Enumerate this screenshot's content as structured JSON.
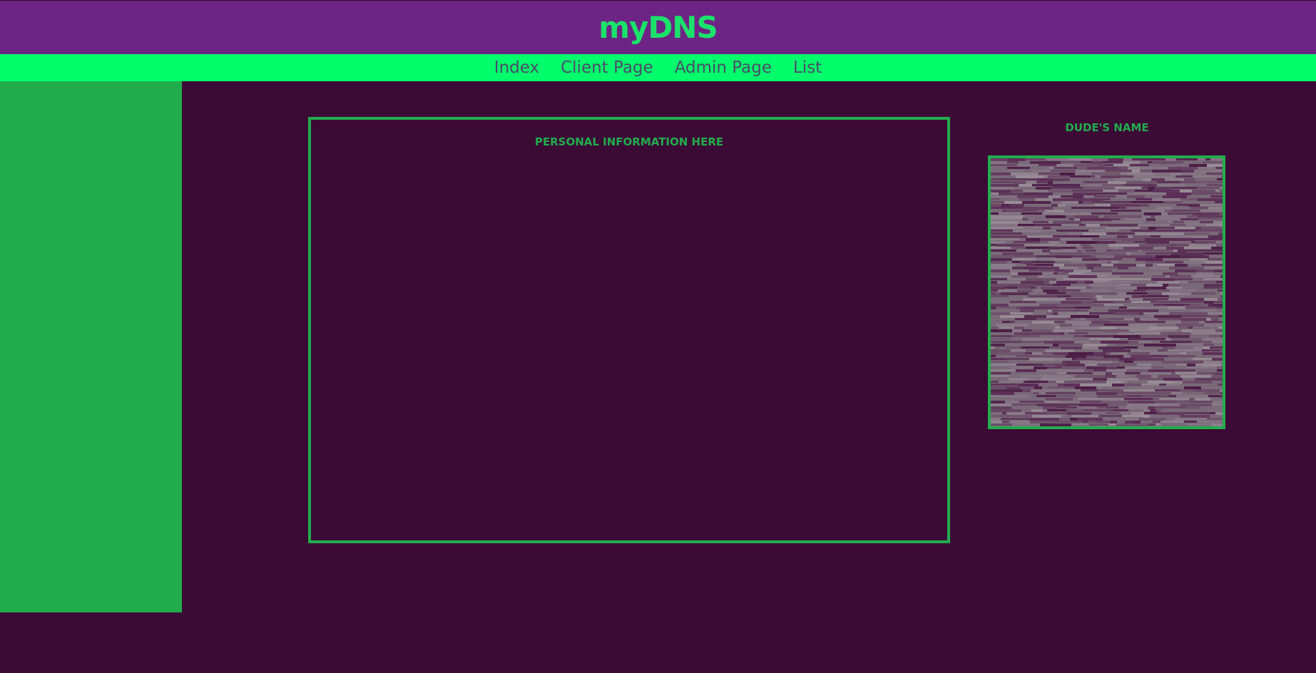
{
  "header": {
    "title": "myDNS"
  },
  "nav": {
    "items": [
      {
        "label": "Index"
      },
      {
        "label": "Client Page"
      },
      {
        "label": "Admin Page"
      },
      {
        "label": "List"
      }
    ]
  },
  "main": {
    "info_heading": "PERSONAL INFORMATION HERE",
    "profile_name": "DUDE'S NAME",
    "profile_photo_icon": "noise-image"
  },
  "colors": {
    "header_bg": "#6e2484",
    "title": "#1be26b",
    "nav_bg": "#00ff6a",
    "nav_text": "#4b4b6a",
    "page_bg": "#3b0a35",
    "accent": "#22ad4d"
  }
}
